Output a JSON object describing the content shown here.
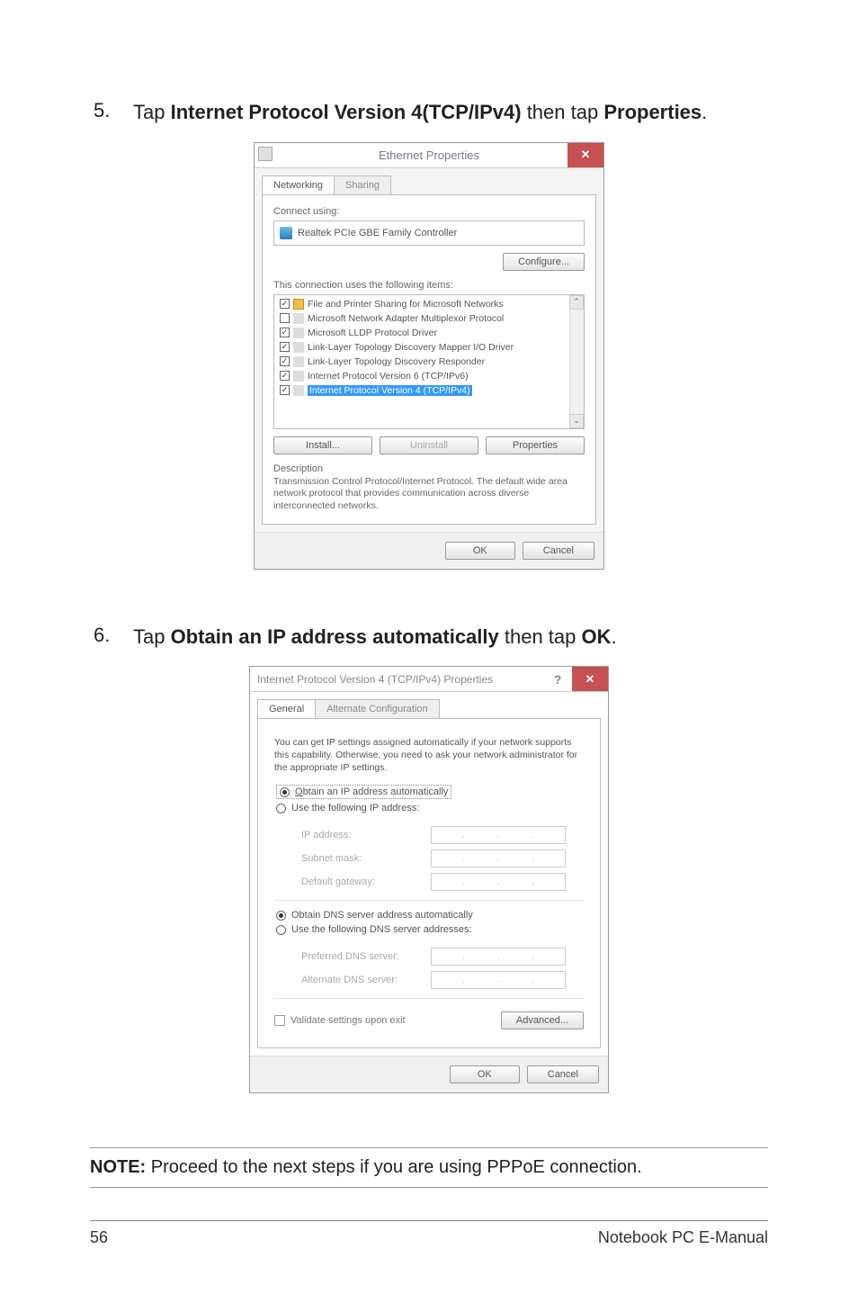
{
  "step5": {
    "num": "5.",
    "text_before": "Tap ",
    "bold1": "Internet Protocol Version 4(TCP/IPv4)",
    "text_mid": " then tap ",
    "bold2": "Properties",
    "text_after": "."
  },
  "dlg1": {
    "title": "Ethernet Properties",
    "close": "✕",
    "tabs": {
      "networking": "Networking",
      "sharing": "Sharing"
    },
    "connect_using": "Connect using:",
    "adapter": "Realtek PCIe GBE Family Controller",
    "configure": "Configure...",
    "items_label": "This connection uses the following items:",
    "items": [
      {
        "checked": true,
        "label": "File and Printer Sharing for Microsoft Networks"
      },
      {
        "checked": false,
        "label": "Microsoft Network Adapter Multiplexor Protocol"
      },
      {
        "checked": true,
        "label": "Microsoft LLDP Protocol Driver"
      },
      {
        "checked": true,
        "label": "Link-Layer Topology Discovery Mapper I/O Driver"
      },
      {
        "checked": true,
        "label": "Link-Layer Topology Discovery Responder"
      },
      {
        "checked": true,
        "label": "Internet Protocol Version 6 (TCP/IPv6)"
      },
      {
        "checked": true,
        "label": "Internet Protocol Version 4 (TCP/IPv4)",
        "selected": true
      }
    ],
    "install": "Install...",
    "uninstall": "Uninstall",
    "properties": "Properties",
    "desc_title": "Description",
    "desc_text": "Transmission Control Protocol/Internet Protocol. The default wide area network protocol that provides communication across diverse interconnected networks.",
    "ok": "OK",
    "cancel": "Cancel"
  },
  "step6": {
    "num": "6.",
    "text_before": "Tap ",
    "bold1": "Obtain an IP address automatically",
    "text_mid": " then tap ",
    "bold2": "OK",
    "text_after": "."
  },
  "dlg2": {
    "title": "Internet Protocol Version 4 (TCP/IPv4) Properties",
    "help": "?",
    "close": "✕",
    "tabs": {
      "general": "General",
      "alt": "Alternate Configuration"
    },
    "intro": "You can get IP settings assigned automatically if your network supports this capability. Otherwise, you need to ask your network administrator for the appropriate IP settings.",
    "r_obtain_ip": "Obtain an IP address automatically",
    "r_use_ip": "Use the following IP address:",
    "f_ip": "IP address:",
    "f_mask": "Subnet mask:",
    "f_gw": "Default gateway:",
    "r_obtain_dns": "Obtain DNS server address automatically",
    "r_use_dns": "Use the following DNS server addresses:",
    "f_dns1": "Preferred DNS server:",
    "f_dns2": "Alternate DNS server:",
    "validate": "Validate settings upon exit",
    "advanced": "Advanced...",
    "ok": "OK",
    "cancel": "Cancel"
  },
  "note": {
    "label": "NOTE:",
    "text": " Proceed to the next steps if you are using PPPoE connection."
  },
  "footer": {
    "page": "56",
    "title": "Notebook PC E-Manual"
  }
}
